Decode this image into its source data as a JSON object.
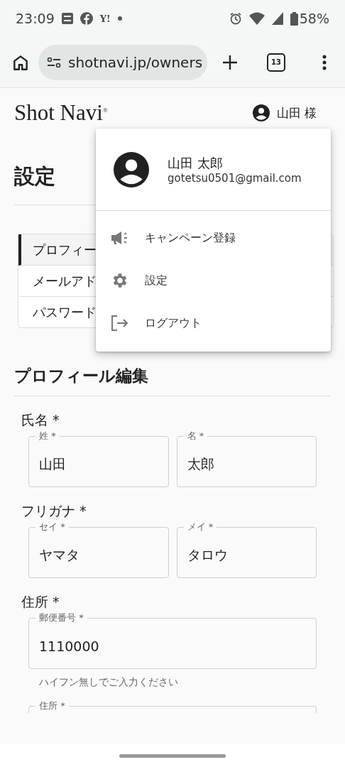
{
  "status_bar": {
    "time": "23:09",
    "notification_text": "Y!",
    "battery": "58%"
  },
  "browser": {
    "url": "shotnavi.jp/owners",
    "tab_count": "13"
  },
  "header": {
    "logo": "Shot Navi$^{®}$",
    "user_label": "山田 様"
  },
  "page_title": "設定",
  "settings_nav": [
    {
      "label": "プロフィー",
      "selected": true
    },
    {
      "label": "メールアド",
      "selected": false
    },
    {
      "label": "パスワード",
      "selected": false
    }
  ],
  "user_menu": {
    "name": "山田 太郎",
    "email": "gotetsu0501@gmail.com",
    "items": [
      {
        "kind": "campaign",
        "label": "キャンペーン登録"
      },
      {
        "kind": "settings",
        "label": "設定"
      },
      {
        "kind": "logout",
        "label": "ログアウト"
      }
    ]
  },
  "section_title": "プロフィール編集",
  "form_groups": [
    {
      "label": "氏名 *",
      "fields": [
        {
          "label": "姓 *",
          "value": "山田"
        },
        {
          "label": "名 *",
          "value": "太郎"
        }
      ]
    },
    {
      "label": "フリガナ *",
      "fields": [
        {
          "label": "セイ *",
          "value": "ヤマタ"
        },
        {
          "label": "メイ *",
          "value": "タロウ"
        }
      ]
    },
    {
      "label": "住所 *",
      "fields": [
        {
          "label": "郵便番号 *",
          "value": "1110000",
          "helper": "ハイフン無しでご入力ください"
        },
        {
          "label": "住所 *"
        }
      ]
    }
  ]
}
